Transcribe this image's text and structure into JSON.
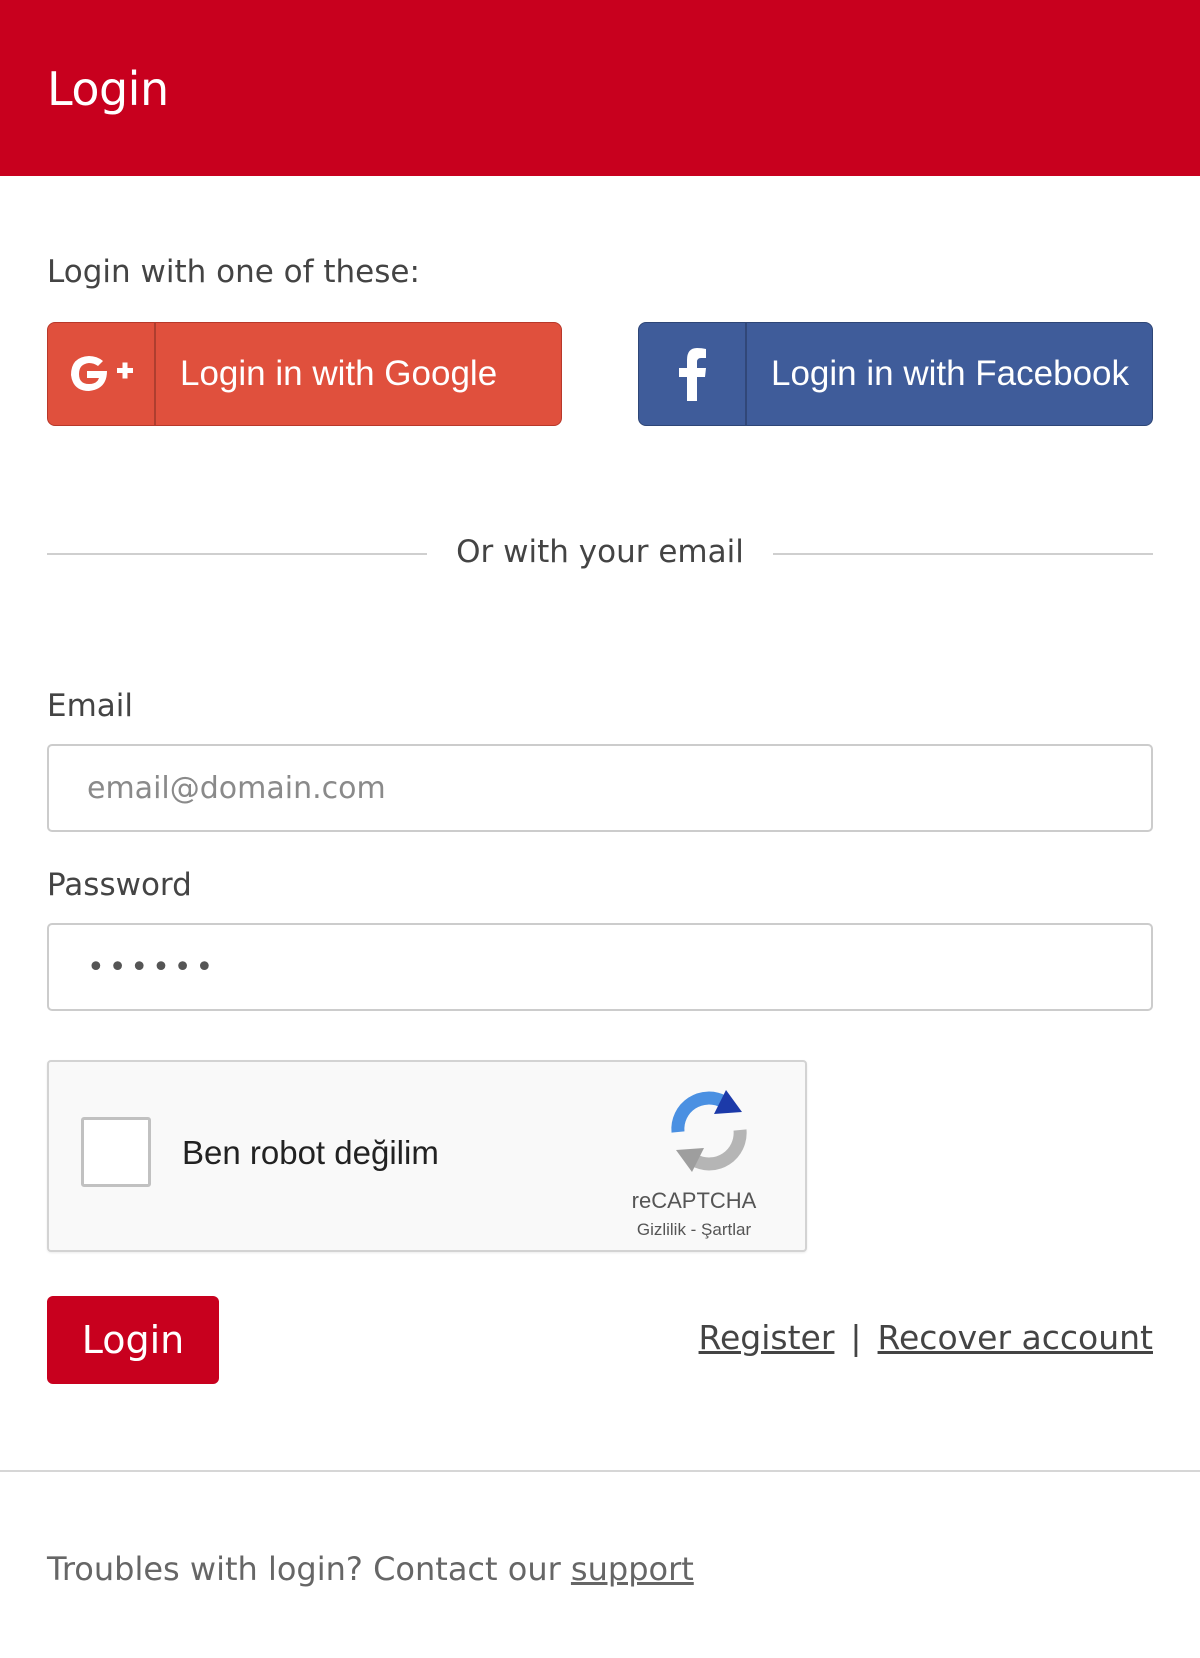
{
  "header": {
    "title": "Login"
  },
  "intro": "Login with one of these:",
  "social": {
    "google": {
      "label": "Login in with Google",
      "color": "#e0503d"
    },
    "facebook": {
      "label": "Login in with Facebook",
      "color": "#3f5c9a"
    }
  },
  "divider": "Or with your email",
  "form": {
    "email_label": "Email",
    "email_placeholder": "email@domain.com",
    "password_label": "Password",
    "password_value": "••••••"
  },
  "captcha": {
    "label": "Ben robot değilim",
    "brand": "reCAPTCHA",
    "links": "Gizlilik - Şartlar"
  },
  "actions": {
    "login_label": "Login",
    "register_label": "Register",
    "separator": "|",
    "recover_label": "Recover account"
  },
  "footer": {
    "text": "Troubles with login? Contact our",
    "support_label": "support"
  },
  "colors": {
    "brand": "#c8001e"
  }
}
